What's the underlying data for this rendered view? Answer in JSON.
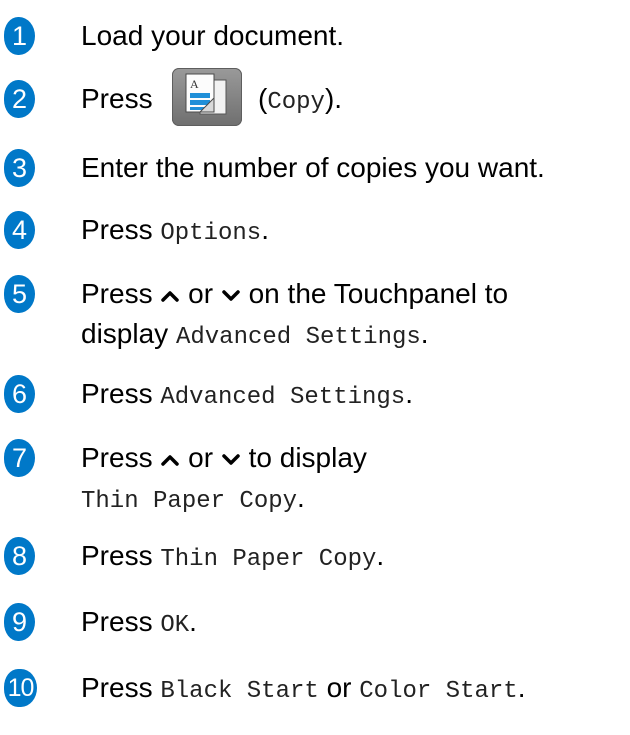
{
  "steps": [
    {
      "num": "1",
      "text": "Load your document."
    },
    {
      "num": "2",
      "press": "Press",
      "paren_open": "(",
      "button": "Copy",
      "close": ")."
    },
    {
      "num": "3",
      "text": "Enter the number of copies you want."
    },
    {
      "num": "4",
      "press": "Press",
      "option": "Options",
      "end": "."
    },
    {
      "num": "5",
      "press": "Press",
      "or": "or",
      "rest": "on the Touchpanel to",
      "line2_prefix": "display",
      "option": "Advanced Settings",
      "end": "."
    },
    {
      "num": "6",
      "press": "Press",
      "option": "Advanced Settings",
      "end": "."
    },
    {
      "num": "7",
      "press": "Press",
      "or": "or",
      "rest": "to display",
      "option": "Thin Paper Copy",
      "end": "."
    },
    {
      "num": "8",
      "press": "Press",
      "option": "Thin Paper Copy",
      "end": "."
    },
    {
      "num": "9",
      "press": "Press",
      "option": "OK",
      "end": "."
    },
    {
      "num": "10",
      "press": "Press",
      "option_a": "Black Start",
      "or": "or",
      "option_b": "Color Start",
      "end": "."
    }
  ],
  "icons": {
    "copy_button": "copy-icon",
    "up": "chevron-up-icon",
    "down": "chevron-down-icon"
  },
  "colors": {
    "badge": "#0078c8"
  }
}
